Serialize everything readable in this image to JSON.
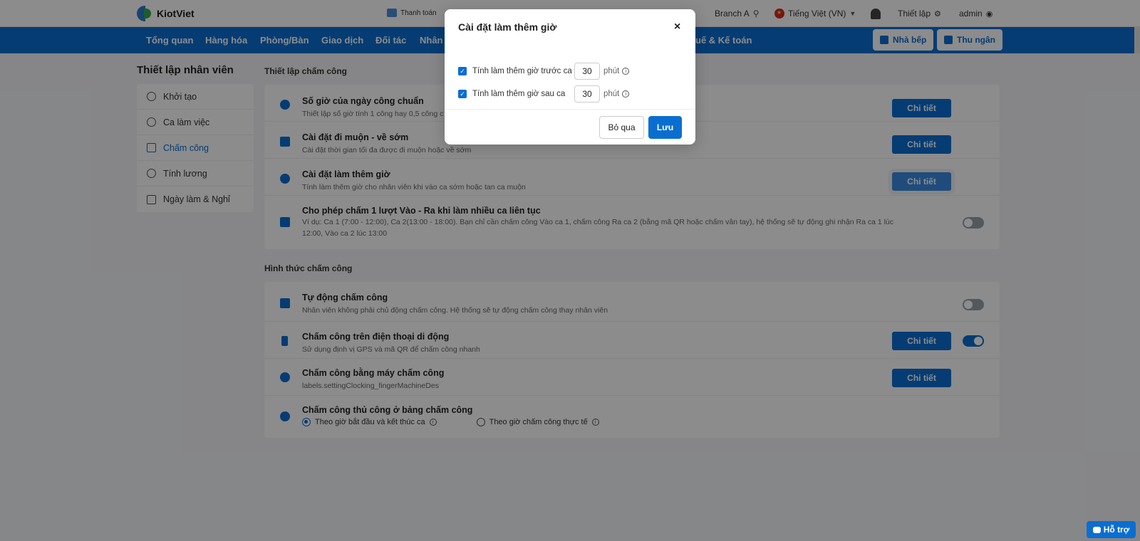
{
  "app": {
    "logo_text": "KiotViet"
  },
  "topbar": {
    "payment": "Thanh toán",
    "branch": "Branch A",
    "language": "Tiếng Việt (VN)",
    "settings": "Thiết lập",
    "user": "admin"
  },
  "nav": {
    "items": [
      "Tổng quan",
      "Hàng hóa",
      "Phòng/Bàn",
      "Giao dịch",
      "Đối tác",
      "Nhân v",
      "uế & Kế toán"
    ],
    "kitchen": "Nhà bếp",
    "cashier": "Thu ngân"
  },
  "sidebar": {
    "title": "Thiết lập nhân viên",
    "items": [
      {
        "label": "Khởi tạo",
        "icon": "gear-icon"
      },
      {
        "label": "Ca làm việc",
        "icon": "clock-icon"
      },
      {
        "label": "Chấm công",
        "icon": "calendar-check-icon"
      },
      {
        "label": "Tính lương",
        "icon": "dollar-icon"
      },
      {
        "label": "Ngày làm & Nghỉ",
        "icon": "calendar-icon"
      }
    ]
  },
  "attendance_settings": {
    "title": "Thiết lập chấm công",
    "rows": [
      {
        "title": "Số giờ của ngày công chuẩn",
        "desc": "Thiết lập số giờ tính 1 công hay 0,5 công c",
        "button": "Chi tiết"
      },
      {
        "title": "Cài đặt đi muộn - về sớm",
        "desc": "Cài đặt thời gian tối đa được đi muộn hoặc về sớm",
        "button": "Chi tiết"
      },
      {
        "title": "Cài đặt làm thêm giờ",
        "desc": "Tính làm thêm giờ cho nhân viên khi vào ca sớm hoặc tan ca muộn",
        "button": "Chi tiết"
      },
      {
        "title": "Cho phép chấm 1 lượt Vào - Ra khi làm nhiều ca liên tục",
        "desc": "Ví dụ: Ca 1 (7:00 - 12:00), Ca 2(13:00 - 18:00). Bạn chỉ cần chấm công Vào ca 1, chấm công Ra ca 2 (bằng mã QR hoặc chấm vân tay), hệ thống sẽ tự động ghi nhận Ra ca 1 lúc 12:00, Vào ca 2 lúc 13:00"
      }
    ]
  },
  "attendance_methods": {
    "title": "Hình thức chấm công",
    "rows": [
      {
        "title": "Tự động chấm công",
        "desc": "Nhân viên không phải chủ động chấm công. Hệ thống sẽ tự động chấm công thay nhân viên"
      },
      {
        "title": "Chấm công trên điện thoại di động",
        "desc": "Sử dụng định vị GPS và mã QR để chấm công nhanh",
        "button": "Chi tiết"
      },
      {
        "title": "Chấm công bằng máy chấm công",
        "desc": "labels.settingClocking_fingerMachineDes",
        "button": "Chi tiết"
      },
      {
        "title": "Chấm công thủ công ở bảng chấm công",
        "option1": "Theo giờ bắt đầu và kết thúc ca",
        "option2": "Theo giờ chấm công thực tế"
      }
    ]
  },
  "modal": {
    "title": "Cài đặt làm thêm giờ",
    "close": "×",
    "before_label": "Tính làm thêm giờ trước ca",
    "before_value": "30",
    "after_label": "Tính làm thêm giờ sau ca",
    "after_value": "30",
    "unit": "phút",
    "skip": "Bỏ qua",
    "save": "Lưu"
  },
  "support": "Hỗ trợ"
}
